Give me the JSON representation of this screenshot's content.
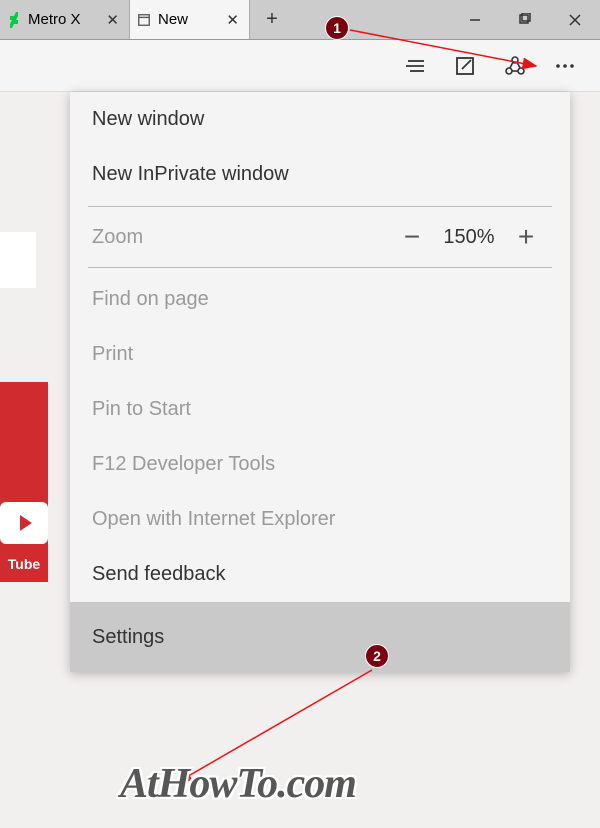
{
  "tabs": [
    {
      "label": "Metro X"
    },
    {
      "label": "New"
    }
  ],
  "window_controls": {
    "minimize": "–",
    "maximize": "❐",
    "close": "✕"
  },
  "zoom": {
    "label": "Zoom",
    "value": "150%"
  },
  "menu": {
    "new_window": "New window",
    "new_private": "New InPrivate window",
    "find": "Find on page",
    "print": "Print",
    "pin": "Pin to Start",
    "devtools": "F12 Developer Tools",
    "open_ie": "Open with Internet Explorer",
    "feedback": "Send feedback",
    "settings": "Settings"
  },
  "sidebar": {
    "youtube_label": "Tube"
  },
  "markers": {
    "one": "1",
    "two": "2"
  },
  "watermark": "AtHowTo.com"
}
